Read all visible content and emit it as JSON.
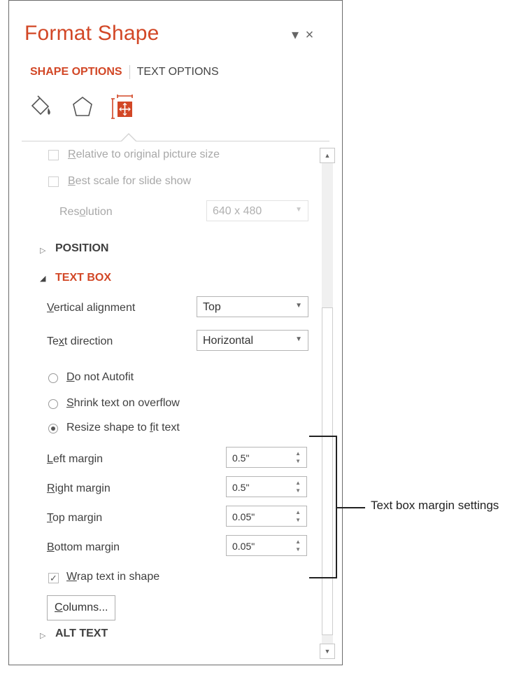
{
  "panel": {
    "title": "Format Shape",
    "header_buttons": {
      "menu_glyph": "▾",
      "close_glyph": "×"
    },
    "tabs": [
      {
        "label": "SHAPE OPTIONS",
        "active": true
      },
      {
        "label": "TEXT OPTIONS",
        "active": false
      }
    ],
    "icons": [
      "fill-line-icon",
      "effects-icon",
      "size-properties-icon"
    ],
    "accent_color": "#d24726"
  },
  "picture": {
    "relative_prefix": "R",
    "relative_rest": "elative to original picture size",
    "best_prefix": "B",
    "best_rest": "est scale for slide show",
    "resolution_a": "Res",
    "resolution_u": "o",
    "resolution_b": "lution",
    "resolution_value": "640 x 480"
  },
  "sections": {
    "position": "POSITION",
    "text_box": "TEXT BOX",
    "alt_text": "ALT TEXT"
  },
  "text_box": {
    "vertical_alignment": {
      "u": "V",
      "rest": "ertical alignment",
      "value": "Top"
    },
    "text_direction": {
      "a": "Te",
      "u": "x",
      "b": "t direction",
      "value": "Horizontal"
    },
    "autofit": [
      {
        "u": "D",
        "rest": "o not Autofit",
        "selected": false
      },
      {
        "u": "S",
        "rest": "hrink text on overflow",
        "selected": false
      },
      {
        "a": "Resize shape to ",
        "u": "f",
        "b": "it text",
        "selected": true
      }
    ],
    "margins": [
      {
        "u": "L",
        "rest": "eft margin",
        "value": "0.5\""
      },
      {
        "u": "R",
        "rest": "ight margin",
        "value": "0.5\""
      },
      {
        "u": "T",
        "rest": "op margin",
        "value": "0.05\""
      },
      {
        "u": "B",
        "rest": "ottom margin",
        "value": "0.05\""
      }
    ],
    "wrap": {
      "u": "W",
      "rest": "rap text in shape",
      "checked": true
    },
    "columns": {
      "u": "C",
      "rest": "olumns..."
    }
  },
  "callout": "Text box margin settings"
}
